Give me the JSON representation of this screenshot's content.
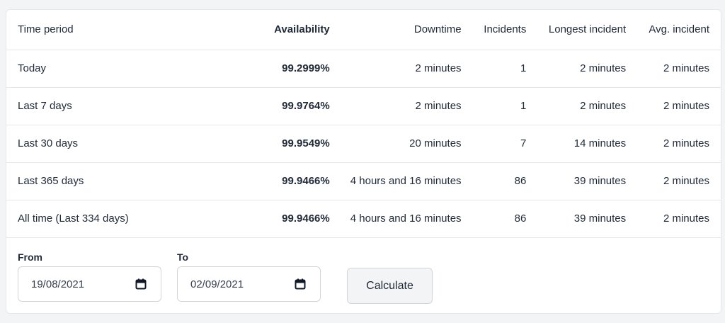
{
  "table": {
    "headers": [
      "Time period",
      "Availability",
      "Downtime",
      "Incidents",
      "Longest incident",
      "Avg. incident"
    ],
    "rows": [
      [
        "Today",
        "99.2999%",
        "2 minutes",
        "1",
        "2 minutes",
        "2 minutes"
      ],
      [
        "Last 7 days",
        "99.9764%",
        "2 minutes",
        "1",
        "2 minutes",
        "2 minutes"
      ],
      [
        "Last 30 days",
        "99.9549%",
        "20 minutes",
        "7",
        "14 minutes",
        "2 minutes"
      ],
      [
        "Last 365 days",
        "99.9466%",
        "4 hours and 16 minutes",
        "86",
        "39 minutes",
        "2 minutes"
      ],
      [
        "All time (Last 334 days)",
        "99.9466%",
        "4 hours and 16 minutes",
        "86",
        "39 minutes",
        "2 minutes"
      ]
    ]
  },
  "range": {
    "from_label": "From",
    "from_value": "19/08/2021",
    "to_label": "To",
    "to_value": "02/09/2021",
    "calculate_label": "Calculate"
  },
  "icons": {
    "date_picker": "calendar-icon"
  }
}
